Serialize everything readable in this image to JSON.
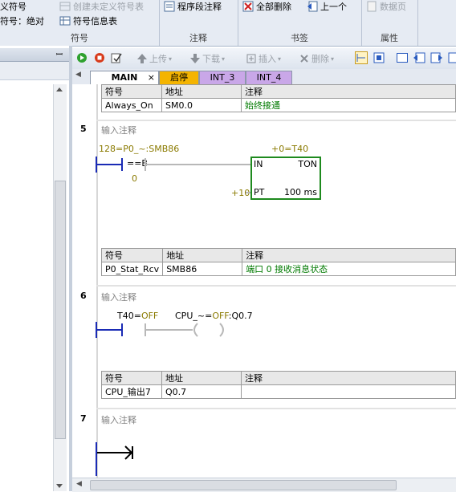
{
  "ribbon": {
    "groups": [
      {
        "caption": "符号",
        "items": [
          "义符号",
          "符号：绝对",
          "创建未定义符号表",
          "符号信息表"
        ]
      },
      {
        "caption": "注释",
        "items": [
          "程序段注释"
        ]
      },
      {
        "caption": "书签",
        "items": [
          "全部删除",
          "上一个"
        ]
      },
      {
        "caption": "属性",
        "items": [
          "数据页"
        ]
      }
    ]
  },
  "toolbar": {
    "upload": "上传",
    "download": "下载",
    "insert": "插入",
    "delete": "删除"
  },
  "tabs": [
    "MAIN",
    "启停",
    "INT_3",
    "INT_4"
  ],
  "left_pin": "ꟷ",
  "network4_table": {
    "headers": [
      "符号",
      "地址",
      "注释"
    ],
    "rows": [
      [
        "Always_On",
        "SM0.0",
        "始终接通"
      ]
    ]
  },
  "network5": {
    "number": "5",
    "comment": "输入注释",
    "compare_top": "128=P0_~:SMB86",
    "compare_op": "==B",
    "compare_bottom": "0",
    "timer_label": "+0=T40",
    "timer_in": "IN",
    "timer_type": "TON",
    "timer_pt_value": "+10",
    "timer_pt": "PT",
    "timer_unit": "100 ms",
    "table": {
      "headers": [
        "符号",
        "地址",
        "注释"
      ],
      "rows": [
        [
          "P0_Stat_Rcv",
          "SMB86",
          "端口 0 接收消息状态"
        ]
      ]
    }
  },
  "network6": {
    "number": "6",
    "comment": "输入注释",
    "contact_label": "T40",
    "contact_state": "OFF",
    "coil_label_prefix": "CPU_~",
    "coil_state": "OFF",
    "coil_addr": ":Q0.7",
    "table": {
      "headers": [
        "符号",
        "地址",
        "注释"
      ],
      "rows": [
        [
          "CPU_输出7",
          "Q0.7",
          ""
        ]
      ]
    }
  },
  "network7": {
    "number": "7",
    "comment": "输入注释"
  },
  "colors": {
    "rail": "#1a2bb5",
    "inactive_wire": "#b8b8b8",
    "comment_green": "#007a00",
    "state_olive": "#8a7a00",
    "timer_box": "#1e8a1e",
    "tab_active": "#ffffff",
    "tab_startstop": "#f4b400",
    "tab_int": "#c9a7e8"
  }
}
